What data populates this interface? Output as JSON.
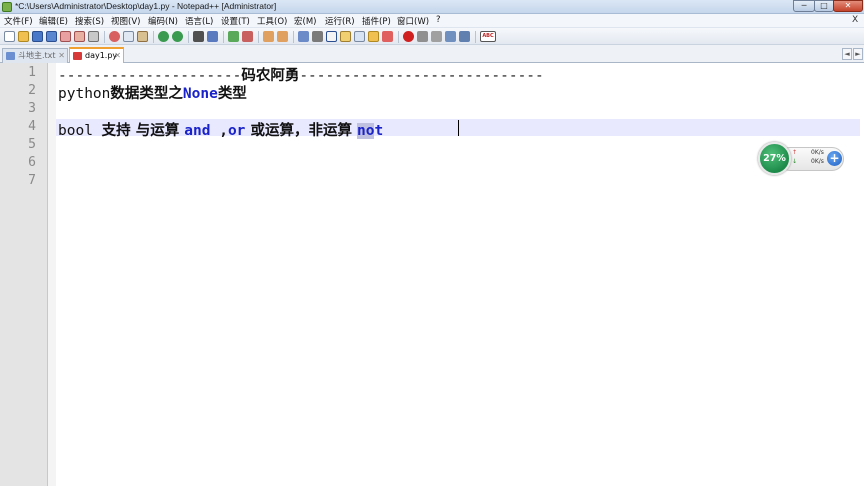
{
  "window": {
    "title": "*C:\\Users\\Administrator\\Desktop\\day1.py - Notepad++ [Administrator]",
    "minimize": "─",
    "maximize": "□",
    "close": "✕"
  },
  "menu": {
    "items": [
      "文件(F)",
      "编辑(E)",
      "搜索(S)",
      "视图(V)",
      "编码(N)",
      "语言(L)",
      "设置(T)",
      "工具(O)",
      "宏(M)",
      "运行(R)",
      "插件(P)",
      "窗口(W)",
      "?"
    ],
    "close_doc": "X"
  },
  "toolbar": {
    "icons": [
      "new-file-icon",
      "open-file-icon",
      "save-icon",
      "save-all-icon",
      "close-icon",
      "close-all-icon",
      "print-icon",
      "cut-icon",
      "copy-icon",
      "paste-icon",
      "undo-icon",
      "redo-icon",
      "find-icon",
      "replace-icon",
      "zoom-in-icon",
      "zoom-out-icon",
      "sync-scroll-v-icon",
      "sync-scroll-h-icon",
      "word-wrap-icon",
      "show-all-chars-icon",
      "indent-guide-icon",
      "document-map-icon",
      "function-list-icon",
      "folder-workspace-icon",
      "monitoring-icon",
      "record-macro-icon",
      "stop-macro-icon",
      "play-macro-icon",
      "run-macro-multiple-icon",
      "save-macro-icon",
      "spell-check-icon"
    ],
    "spell_label": "ABC"
  },
  "tabs": [
    {
      "label": "斗地主.txt",
      "close": "✕",
      "active": false
    },
    {
      "label": "day1.py",
      "close": "✕",
      "active": true
    }
  ],
  "tab_nav": {
    "left": "◄",
    "right": "►"
  },
  "editor": {
    "line_numbers": [
      "1",
      "2",
      "3",
      "4",
      "5",
      "6",
      "7"
    ],
    "line1": {
      "dashes_left": "---------------------",
      "cjk": "码农阿勇",
      "dashes_right": "----------------------------"
    },
    "line2": {
      "plain": "python",
      "cjk1": "数据类型之",
      "kw": "None",
      "cjk2": "类型"
    },
    "line4": {
      "plain": "bool ",
      "cjk1": "支持 与运算 ",
      "kw_and": "and",
      "sep": " ,",
      "kw_or": "or",
      "cjk2": " 或运算，非运算 ",
      "kw_not_sel": "no",
      "kw_not_rest": "t"
    }
  },
  "net_widget": {
    "percent": "27%",
    "upload": "0K/s",
    "download": "0K/s",
    "up_arrow": "↑",
    "down_arrow": "↓",
    "plus": "+"
  },
  "colors": {
    "keyword": "#1a23c9",
    "current_line": "#e8e8ff",
    "gutter": "#e4e4e4",
    "active_tab_accent": "#f0a030"
  }
}
